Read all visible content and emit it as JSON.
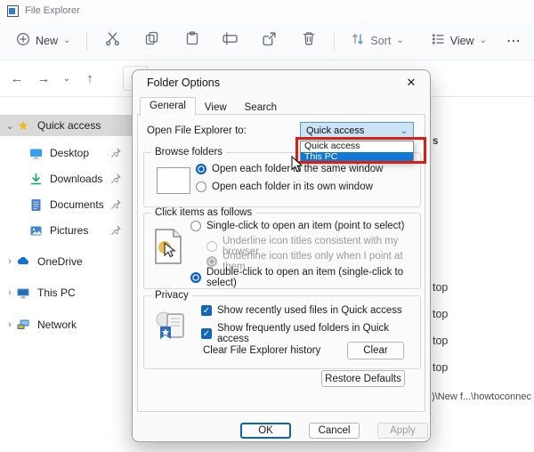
{
  "window": {
    "title": "File Explorer"
  },
  "glyphs": {
    "back": "←",
    "forward": "→",
    "up": "↑",
    "chevron_down": "⌄",
    "chevron_right": "›",
    "star": "★",
    "more": "⋯",
    "close": "✕"
  },
  "toolbar": {
    "new_label": "New",
    "sort_label": "Sort",
    "view_label": "View"
  },
  "sidebar": {
    "quick_access": {
      "label": "Quick access"
    },
    "pinned": [
      {
        "label": "Desktop",
        "icon": "desktop-icon"
      },
      {
        "label": "Downloads",
        "icon": "downloads-icon"
      },
      {
        "label": "Documents",
        "icon": "documents-icon"
      },
      {
        "label": "Pictures",
        "icon": "pictures-icon"
      }
    ],
    "roots": [
      {
        "label": "OneDrive",
        "icon": "onedrive-icon"
      },
      {
        "label": "This PC",
        "icon": "this-pc-icon"
      },
      {
        "label": "Network",
        "icon": "network-icon"
      }
    ]
  },
  "content": {
    "fragment_s": "s",
    "rows": [
      "top",
      "top",
      "top",
      "top"
    ],
    "path_fragment": ":)\\New f...\\howtoconnec"
  },
  "dialog": {
    "title": "Folder Options",
    "tabs": [
      {
        "label": "General"
      },
      {
        "label": "View"
      },
      {
        "label": "Search"
      }
    ],
    "open_to": {
      "label": "Open File Explorer to:",
      "value": "Quick access",
      "options": [
        {
          "label": "Quick access",
          "highlighted": false
        },
        {
          "label": "This PC",
          "highlighted": true
        }
      ]
    },
    "browse": {
      "title": "Browse folders",
      "options": [
        {
          "label": "Open each folder in the same window",
          "selected": true
        },
        {
          "label": "Open each folder in its own window",
          "selected": false
        }
      ]
    },
    "click": {
      "title": "Click items as follows",
      "options": [
        {
          "label": "Single-click to open an item (point to select)",
          "selected": false,
          "disabled": false
        },
        {
          "label": "Underline icon titles consistent with my browser",
          "selected": false,
          "disabled": true
        },
        {
          "label": "Underline icon titles only when I point at them",
          "selected": true,
          "disabled": true
        },
        {
          "label": "Double-click to open an item (single-click to select)",
          "selected": true,
          "disabled": false
        }
      ]
    },
    "privacy": {
      "title": "Privacy",
      "checkboxes": [
        {
          "label": "Show recently used files in Quick access",
          "checked": true
        },
        {
          "label": "Show frequently used folders in Quick access",
          "checked": true
        }
      ],
      "clear_label": "Clear File Explorer history",
      "clear_button": "Clear"
    },
    "restore_button": "Restore Defaults",
    "buttons": {
      "ok": "OK",
      "cancel": "Cancel",
      "apply": "Apply"
    }
  },
  "colors": {
    "accent": "#0b62c4",
    "selection": "#0f77d4",
    "annotation_red": "#dd1d14",
    "star_yellow": "#f2b30d",
    "combo_focus_bg": "#cce3f5"
  }
}
